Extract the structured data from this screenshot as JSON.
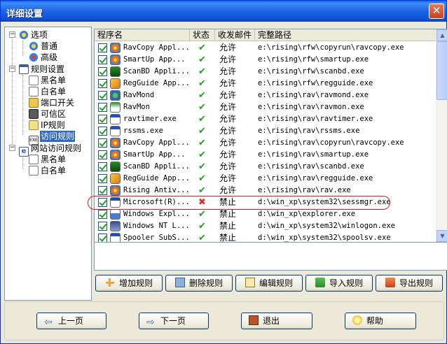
{
  "window": {
    "title": "详细设置",
    "close_glyph": "✕"
  },
  "tree": {
    "items": [
      {
        "label": "选项",
        "icon": "gear-icon",
        "level": 0,
        "expander": "−"
      },
      {
        "label": "普通",
        "icon": "gear-icon",
        "level": 1
      },
      {
        "label": "高级",
        "icon": "gear-star-icon",
        "level": 1
      },
      {
        "label": "规则设置",
        "icon": "rules-icon",
        "level": 0,
        "expander": "−"
      },
      {
        "label": "黑名单",
        "icon": "document-icon",
        "level": 1
      },
      {
        "label": "白名单",
        "icon": "document-icon",
        "level": 1
      },
      {
        "label": "端口开关",
        "icon": "port-icon",
        "level": 1
      },
      {
        "label": "可信区",
        "icon": "network-icon",
        "level": 1
      },
      {
        "label": "IP规则",
        "icon": "ip-icon",
        "level": 1
      },
      {
        "label": "访问规则",
        "icon": "exe-icon",
        "level": 1,
        "selected": true
      },
      {
        "label": "网站访问规则",
        "icon": "ie-icon",
        "level": 0,
        "expander": "−"
      },
      {
        "label": "黑名单",
        "icon": "document-icon",
        "level": 1
      },
      {
        "label": "白名单",
        "icon": "document-icon",
        "level": 1
      }
    ]
  },
  "table": {
    "columns": [
      "程序名",
      "状态",
      "收发邮件",
      "完整路径"
    ],
    "rows": [
      {
        "name": "RavCopy Appl...",
        "status": "ok",
        "mail": "允许",
        "path": "e:\\rising\\rfw\\copyrun\\ravcopy.exe",
        "icon": "rising-icon"
      },
      {
        "name": "SmartUp  App...",
        "status": "ok",
        "mail": "允许",
        "path": "e:\\rising\\rfw\\smartup.exe",
        "icon": "rising-icon"
      },
      {
        "name": "ScanBD Appli...",
        "status": "ok",
        "mail": "允许",
        "path": "e:\\rising\\rfw\\scanbd.exe",
        "icon": "shield-icon"
      },
      {
        "name": "RegGuide App...",
        "status": "ok",
        "mail": "允许",
        "path": "e:\\rising\\rfw\\regguide.exe",
        "icon": "regguide-icon"
      },
      {
        "name": "RavMond",
        "status": "ok",
        "mail": "允许",
        "path": "e:\\rising\\rav\\ravmond.exe",
        "icon": "globe-icon"
      },
      {
        "name": "RavMon",
        "status": "ok",
        "mail": "允许",
        "path": "e:\\rising\\rav\\ravmon.exe",
        "icon": "umbrella-icon"
      },
      {
        "name": "ravtimer.exe",
        "status": "ok",
        "mail": "允许",
        "path": "e:\\rising\\rav\\ravtimer.exe",
        "icon": "window-icon"
      },
      {
        "name": "rssms.exe",
        "status": "ok",
        "mail": "允许",
        "path": "e:\\rising\\rav\\rssms.exe",
        "icon": "window-icon"
      },
      {
        "name": "RavCopy Appl...",
        "status": "ok",
        "mail": "允许",
        "path": "e:\\rising\\rav\\copyrun\\ravcopy.exe",
        "icon": "rising-icon"
      },
      {
        "name": "SmartUp  App...",
        "status": "ok",
        "mail": "允许",
        "path": "e:\\rising\\rav\\smartup.exe",
        "icon": "rising-icon"
      },
      {
        "name": "ScanBD Appli...",
        "status": "ok",
        "mail": "允许",
        "path": "e:\\rising\\rav\\scanbd.exe",
        "icon": "shield-icon"
      },
      {
        "name": "RegGuide App...",
        "status": "ok",
        "mail": "允许",
        "path": "e:\\rising\\rav\\regguide.exe",
        "icon": "regguide-icon"
      },
      {
        "name": "Rising Antiv...",
        "status": "ok",
        "mail": "允许",
        "path": "e:\\rising\\rav\\rav.exe",
        "icon": "rising-icon"
      },
      {
        "name": "Microsoft(R)...",
        "status": "deny",
        "mail": "禁止",
        "path": "d:\\win_xp\\system32\\sessmgr.exe",
        "icon": "window-icon"
      },
      {
        "name": "Windows Expl...",
        "status": "ok",
        "mail": "禁止",
        "path": "d:\\win_xp\\explorer.exe",
        "icon": "explorer-icon"
      },
      {
        "name": "Windows NT L...",
        "status": "ok",
        "mail": "禁止",
        "path": "d:\\win_xp\\system32\\winlogon.exe",
        "icon": "winlogon-icon"
      },
      {
        "name": "Spooler SubS...",
        "status": "ok",
        "mail": "禁止",
        "path": "d:\\win_xp\\system32\\spoolsv.exe",
        "icon": "window-icon"
      }
    ],
    "status_glyphs": {
      "ok": "✔",
      "deny": "✖"
    }
  },
  "rule_buttons": [
    {
      "label": "增加规则",
      "icon": "plus-icon"
    },
    {
      "label": "删除规则",
      "icon": "delete-icon"
    },
    {
      "label": "编辑规则",
      "icon": "edit-icon"
    },
    {
      "label": "导入规则",
      "icon": "import-icon"
    },
    {
      "label": "导出规则",
      "icon": "export-icon"
    }
  ],
  "nav": {
    "prev": "上一页",
    "next": "下一页",
    "exit": "退出",
    "help": "帮助"
  },
  "colors": {
    "accent": "#316ac5",
    "allow": "#21a121",
    "deny": "#d4322c",
    "highlight": "#d81e1e"
  }
}
